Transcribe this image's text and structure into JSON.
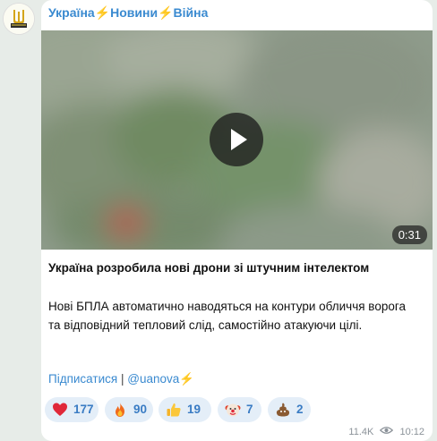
{
  "post": {
    "channel_name": "Україна⚡️Новини⚡️Війна",
    "video_duration": "0:31",
    "headline": "Україна розробила нові дрони зі штучним інтелектом",
    "body": "Нові БПЛА автоматично наводяться на контури обличчя ворога та відповідний тепловий слід, самостійно атакуючи цілі.",
    "subscribe_label": "Підписатися",
    "separator": "|",
    "channel_handle": "@uanova⚡️",
    "reactions": [
      {
        "emoji": "heart-icon",
        "count": "177"
      },
      {
        "emoji": "fire-icon",
        "count": "90"
      },
      {
        "emoji": "thumbs-up-icon",
        "count": "19"
      },
      {
        "emoji": "clown-icon",
        "count": "7"
      },
      {
        "emoji": "poop-icon",
        "count": "2"
      }
    ],
    "views": "11.4K",
    "time": "10:12"
  },
  "colors": {
    "link": "#3a8ad0",
    "reaction_bg": "#e4eef8",
    "reaction_text": "#3a7cc4",
    "meta": "#8b9299"
  }
}
